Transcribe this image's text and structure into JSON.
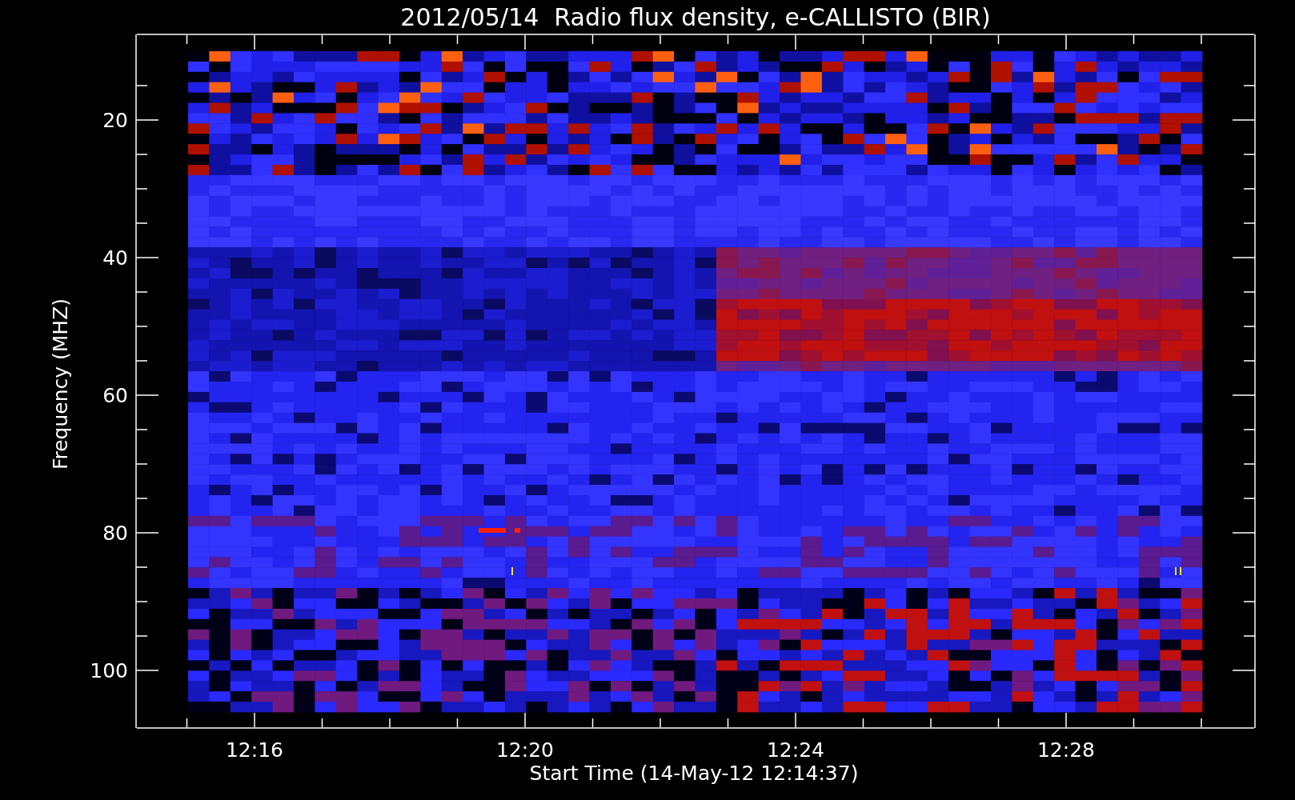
{
  "title": "2012/05/14  Radio flux density, e-CALLISTO (BIR)",
  "y_axis": {
    "label": "Frequency (MHZ)",
    "ticks": [
      "20",
      "40",
      "60",
      "80",
      "100"
    ]
  },
  "x_axis": {
    "label": "Start Time (14-May-12 12:14:37)",
    "ticks": [
      "12:16",
      "12:20",
      "12:24",
      "12:28"
    ]
  }
}
